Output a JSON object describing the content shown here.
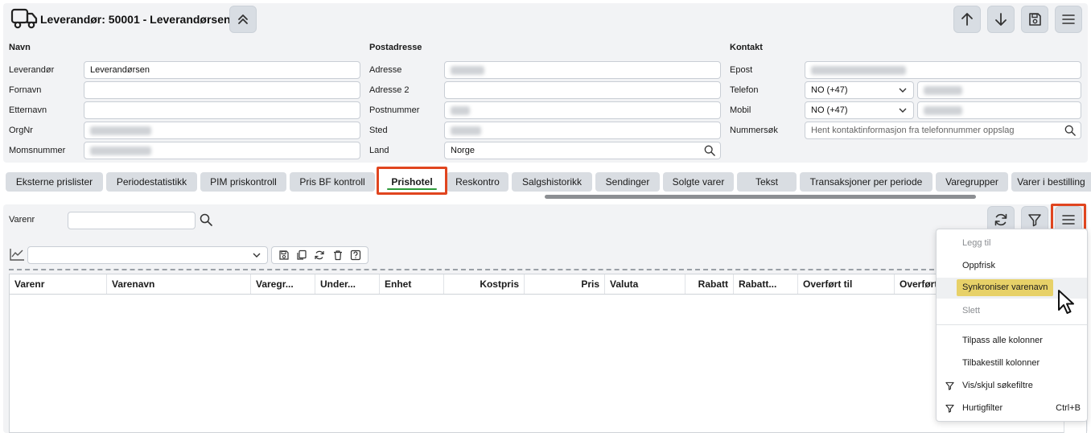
{
  "header": {
    "title": "Leverandør: 50001 - Leverandørsen"
  },
  "sections": {
    "navn": "Navn",
    "postadresse": "Postadresse",
    "kontakt": "Kontakt"
  },
  "navn_fields": {
    "leverandor_label": "Leverandør",
    "leverandor_value": "Leverandørsen",
    "fornavn_label": "Fornavn",
    "etternavn_label": "Etternavn",
    "orgnr_label": "OrgNr",
    "momsnummer_label": "Momsnummer"
  },
  "post_fields": {
    "adresse_label": "Adresse",
    "adresse2_label": "Adresse 2",
    "postnummer_label": "Postnummer",
    "sted_label": "Sted",
    "land_label": "Land",
    "land_value": "Norge"
  },
  "kontakt_fields": {
    "epost_label": "Epost",
    "telefon_label": "Telefon",
    "telefon_country": "NO (+47)",
    "mobil_label": "Mobil",
    "mobil_country": "NO (+47)",
    "nummersok_label": "Nummersøk",
    "nummersok_placeholder": "Hent kontaktinformasjon fra telefonnummer oppslag"
  },
  "tabs": [
    {
      "label": "Eksterne prislister"
    },
    {
      "label": "Periodestatistikk"
    },
    {
      "label": "PIM priskontroll"
    },
    {
      "label": "Pris BF kontroll"
    },
    {
      "label": "Prishotel",
      "active": true
    },
    {
      "label": "Reskontro"
    },
    {
      "label": "Salgshistorikk"
    },
    {
      "label": "Sendinger"
    },
    {
      "label": "Solgte varer"
    },
    {
      "label": "Tekst"
    },
    {
      "label": "Transaksjoner per periode"
    },
    {
      "label": "Varegrupper"
    },
    {
      "label": "Varer i bestilling"
    }
  ],
  "filter": {
    "varenr_label": "Varenr"
  },
  "grid": {
    "columns": [
      "Varenr",
      "Varenavn",
      "Varegr...",
      "Under...",
      "Enhet",
      "Kostpris",
      "Pris",
      "Valuta",
      "Rabatt",
      "Rabatt...",
      "Overført til",
      "Overført"
    ]
  },
  "menu": {
    "items": [
      {
        "label": "Legg til",
        "disabled": true
      },
      {
        "label": "Oppfrisk"
      },
      {
        "label": "Synkroniser varenavn",
        "highlighted": true
      },
      {
        "label": "Slett",
        "disabled": true
      },
      {
        "label": "Tilpass alle kolonner"
      },
      {
        "label": "Tilbakestill kolonner"
      },
      {
        "label": "Vis/skjul søkefiltre",
        "icon": "filter-icon"
      },
      {
        "label": "Hurtigfilter",
        "icon": "filter-icon",
        "shortcut": "Ctrl+B"
      }
    ]
  },
  "icons": {
    "truck": "truck-icon",
    "collapse": "chevrons-up-icon",
    "up": "arrow-up-icon",
    "down": "arrow-down-icon",
    "save": "save-icon",
    "menu": "hamburger-menu-icon",
    "refresh": "refresh-icon",
    "filter": "filter-icon",
    "search": "search-icon",
    "chart": "line-chart-icon"
  },
  "colors": {
    "accent_outline": "#e0451f",
    "active_tab_underline": "#2d9b3a",
    "menu_highlight": "#e7d168",
    "panel_bg": "#f2f3f5",
    "button_bg": "#d8dde3"
  }
}
